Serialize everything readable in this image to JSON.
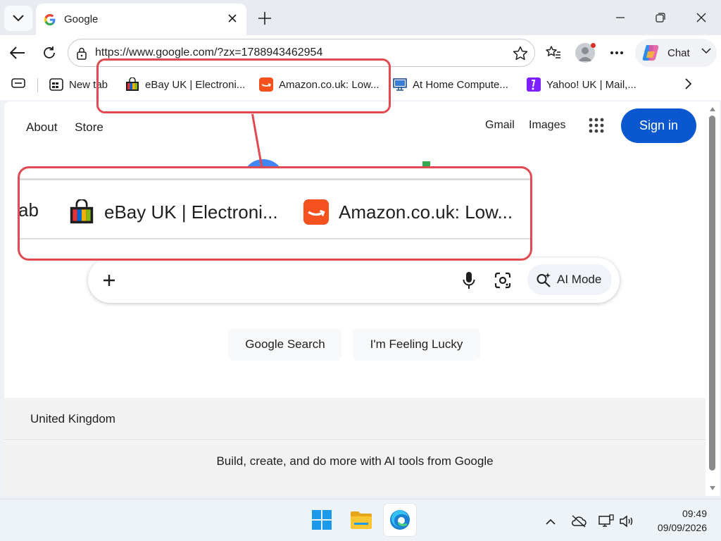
{
  "browser": {
    "tab_title": "Google",
    "url": "https://www.google.com/?zx=1788943462954",
    "chat_label": "Chat"
  },
  "favorites": [
    {
      "label": "New tab",
      "icon": "new-tab-page-icon"
    },
    {
      "label": "eBay UK | Electroni...",
      "icon": "ebay-bag-icon"
    },
    {
      "label": "Amazon.co.uk: Low...",
      "icon": "amazon-icon"
    },
    {
      "label": "At Home Compute...",
      "icon": "computer-monitor-icon"
    },
    {
      "label": "Yahoo! UK | Mail,...",
      "icon": "yahoo-icon"
    }
  ],
  "google": {
    "top_left": [
      "About",
      "Store"
    ],
    "gmail": "Gmail",
    "images": "Images",
    "signin": "Sign in",
    "ai_mode": "AI Mode",
    "search_button": "Google Search",
    "lucky_button": "I'm Feeling Lucky",
    "country": "United Kingdom",
    "promo": "Build, create, and do more with AI tools from Google"
  },
  "zoom_callout": {
    "partial": "ab",
    "item1": "eBay UK | Electroni...",
    "item2": "Amazon.co.uk: Low..."
  },
  "taskbar": {
    "time": "09:49",
    "date": "09/09/2026"
  },
  "colors": {
    "accent": "#0b57d0",
    "annotation": "#e04b52"
  }
}
